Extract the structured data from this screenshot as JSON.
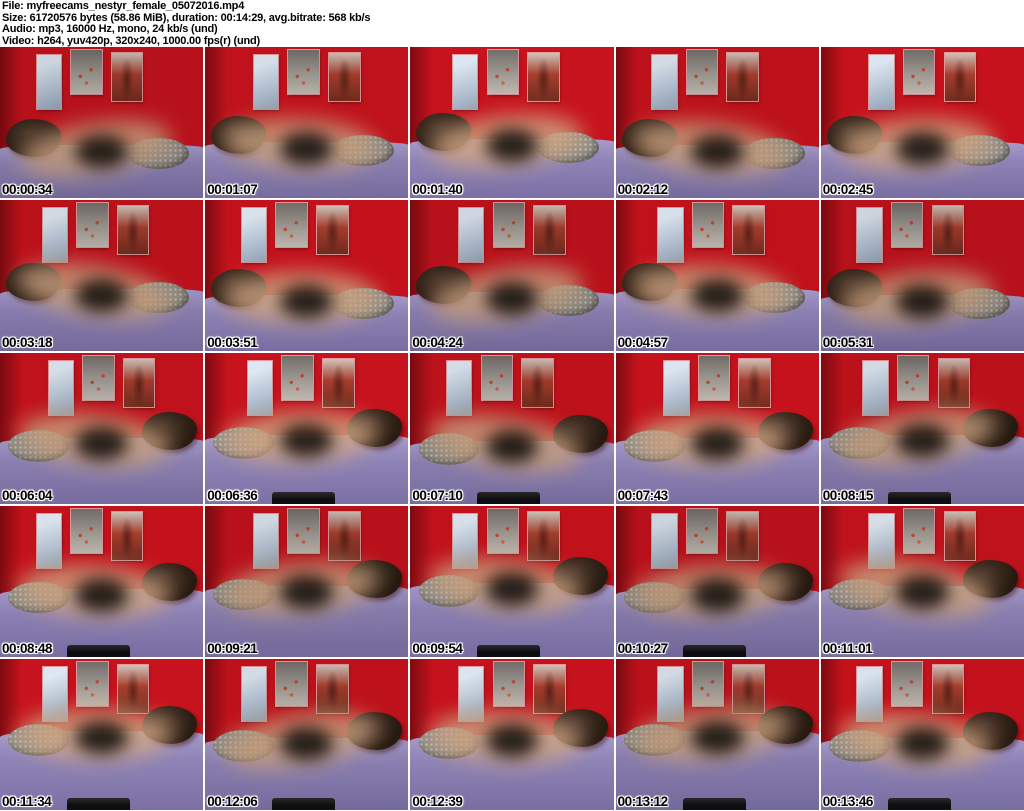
{
  "header": {
    "file": "File: myfreecams_nestyr_female_05072016.mp4",
    "size": "Size: 61720576 bytes (58.86 MiB), duration: 00:14:29, avg.bitrate: 568 kb/s",
    "audio": "Audio: mp3, 16000 Hz, mono, 24 kb/s (und)",
    "video": "Video: h264, yuv420p, 320x240, 1000.00 fps(r) (und)"
  },
  "grid": {
    "columns": 5,
    "rows": 5
  },
  "thumbnails": [
    {
      "timestamp": "00:00:34"
    },
    {
      "timestamp": "00:01:07"
    },
    {
      "timestamp": "00:01:40"
    },
    {
      "timestamp": "00:02:12"
    },
    {
      "timestamp": "00:02:45"
    },
    {
      "timestamp": "00:03:18"
    },
    {
      "timestamp": "00:03:51"
    },
    {
      "timestamp": "00:04:24"
    },
    {
      "timestamp": "00:04:57"
    },
    {
      "timestamp": "00:05:31"
    },
    {
      "timestamp": "00:06:04"
    },
    {
      "timestamp": "00:06:36"
    },
    {
      "timestamp": "00:07:10"
    },
    {
      "timestamp": "00:07:43"
    },
    {
      "timestamp": "00:08:15"
    },
    {
      "timestamp": "00:08:48"
    },
    {
      "timestamp": "00:09:21"
    },
    {
      "timestamp": "00:09:54"
    },
    {
      "timestamp": "00:10:27"
    },
    {
      "timestamp": "00:11:01"
    },
    {
      "timestamp": "00:11:34"
    },
    {
      "timestamp": "00:12:06"
    },
    {
      "timestamp": "00:12:39"
    },
    {
      "timestamp": "00:13:12"
    },
    {
      "timestamp": "00:13:46"
    }
  ],
  "colors": {
    "wall_red": "#c1121c",
    "wall_shadow": "#7c0a10",
    "bed_lavender": "#8b80b2",
    "bed_light": "#a398c6",
    "pillow_brown": "#271a10",
    "cushion_gray": "#8e8a84",
    "pic_blue": "#d7e0ea",
    "pic_gray": "#9b958f",
    "pic_red": "#a23c2c",
    "skin_tone": "#c79e7d",
    "dark_garment": "#17120e",
    "timestamp_text": "#000000",
    "timestamp_outline": "#ffffff",
    "header_bg": "#ffffff",
    "header_text": "#000000"
  }
}
